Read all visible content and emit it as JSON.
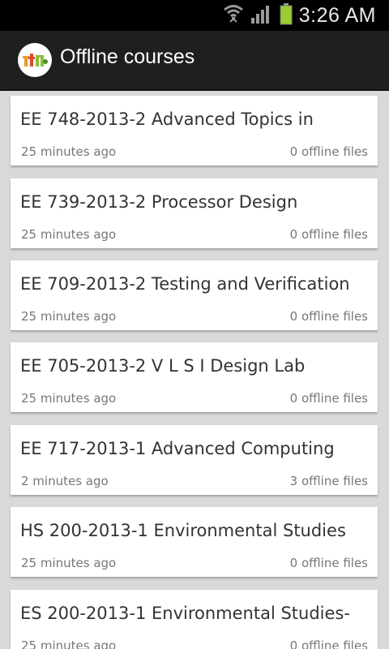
{
  "status_bar": {
    "time": "3:26 AM",
    "icons": [
      "wifi-icon",
      "signal-icon",
      "battery-icon"
    ]
  },
  "action_bar": {
    "title": "Offline courses",
    "logo_icon": "app-logo-icon"
  },
  "courses": [
    {
      "title": "EE 748-2013-2 Advanced Topics in",
      "time": "25 minutes ago",
      "files": "0 offline files"
    },
    {
      "title": "EE 739-2013-2 Processor Design",
      "time": "25 minutes ago",
      "files": "0 offline files"
    },
    {
      "title": "EE 709-2013-2 Testing and Verification",
      "time": "25 minutes ago",
      "files": "0 offline files"
    },
    {
      "title": "EE 705-2013-2 V L S I Design Lab",
      "time": "25 minutes ago",
      "files": "0 offline files"
    },
    {
      "title": "EE 717-2013-1 Advanced Computing",
      "time": "2 minutes ago",
      "files": "3 offline files"
    },
    {
      "title": "HS 200-2013-1 Environmental Studies",
      "time": "25 minutes ago",
      "files": "0 offline files"
    },
    {
      "title": "ES 200-2013-1 Environmental Studies-",
      "time": "25 minutes ago",
      "files": "0 offline files"
    }
  ],
  "colors": {
    "status_bar": "#000000",
    "action_bar": "#1f1f1f",
    "list_background": "#d9d9d9",
    "card": "#ffffff",
    "battery": "#9acd32"
  }
}
